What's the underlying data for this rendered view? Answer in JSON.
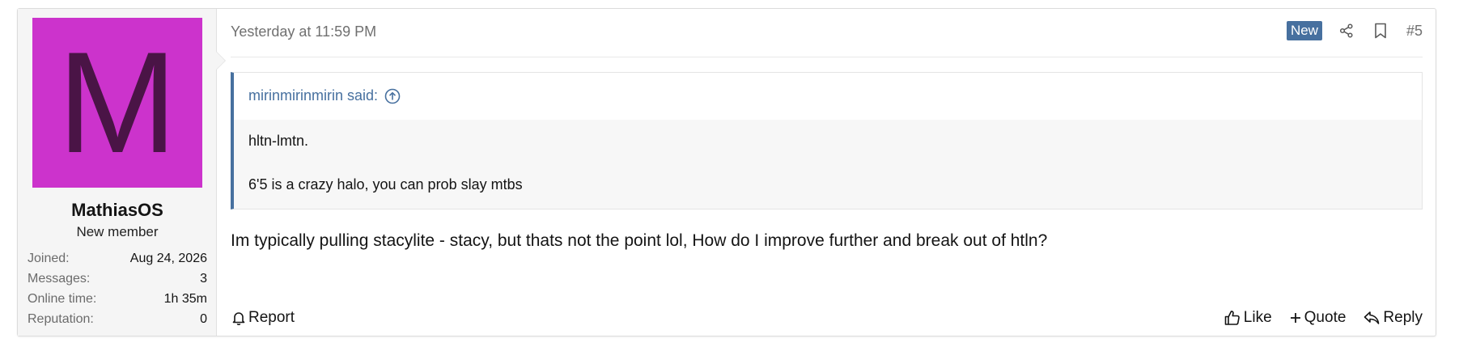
{
  "user": {
    "avatar_letter": "M",
    "avatar_color": "#cc33cc",
    "avatar_letter_color": "#4a1446",
    "name": "MathiasOS",
    "title": "New member",
    "extras": [
      {
        "label": "Joined:",
        "value": "Aug 24, 2026"
      },
      {
        "label": "Messages:",
        "value": "3"
      },
      {
        "label": "Online time:",
        "value": "1h 35m"
      },
      {
        "label": "Reputation:",
        "value": "0"
      }
    ]
  },
  "header": {
    "timestamp": "Yesterday at 11:59 PM",
    "badge": "New",
    "badge_color": "#47709f",
    "share_icon": "share-icon",
    "bookmark_icon": "bookmark-icon",
    "post_number": "#5"
  },
  "quote": {
    "author_line": "mirinmirinmirin said:",
    "jump_icon": "arrow-up-circle-icon",
    "lines": [
      "hltn-lmtn.",
      "6'5 is a crazy halo, you can prob slay mtbs"
    ]
  },
  "message": "Im typically pulling stacylite - stacy, but thats not the point lol, How do I improve further and break out of htln?",
  "footer": {
    "report": "Report",
    "like": "Like",
    "quote": "Quote",
    "reply": "Reply"
  }
}
